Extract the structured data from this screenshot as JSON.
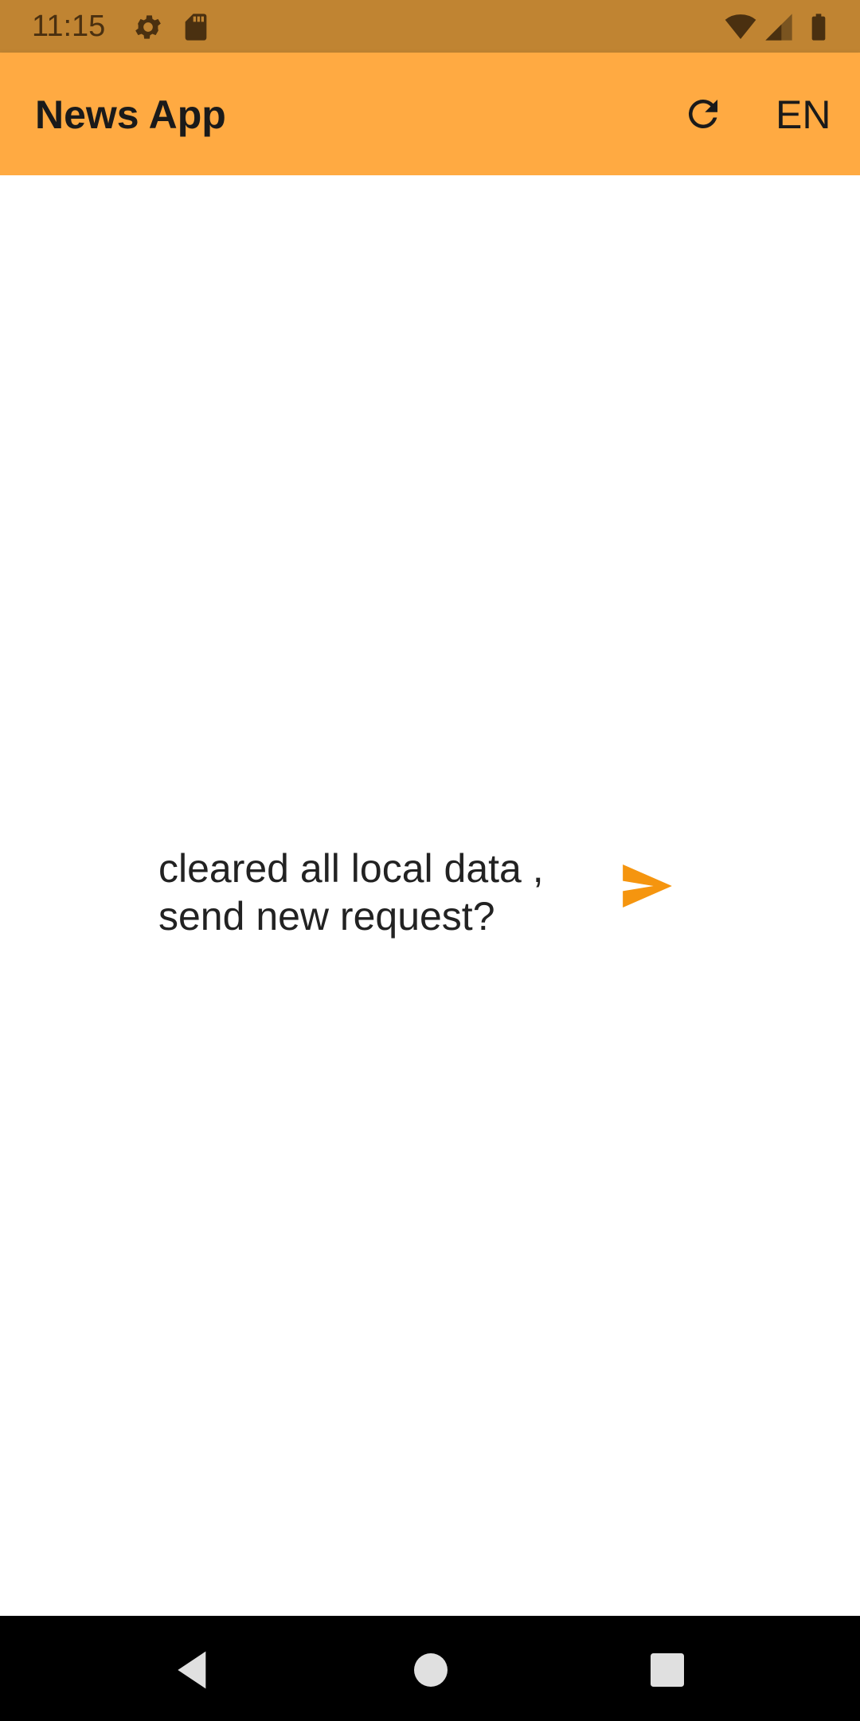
{
  "status_bar": {
    "time": "11:15",
    "icons": [
      "gear-icon",
      "sd-card-icon",
      "wifi-icon",
      "signal-icon",
      "battery-icon"
    ]
  },
  "app_bar": {
    "title": "News App",
    "refresh_icon": "refresh-icon",
    "language": "EN"
  },
  "main": {
    "message_line1": "cleared all local data ,",
    "message_line2": "send new request?",
    "send_icon": "send-icon"
  },
  "nav_bar": {
    "buttons": [
      "back-icon",
      "home-icon",
      "recents-icon"
    ]
  },
  "colors": {
    "status_bar": "#c08432",
    "app_bar": "#ffaa42",
    "accent": "#f5950f",
    "nav_bar": "#000000"
  }
}
